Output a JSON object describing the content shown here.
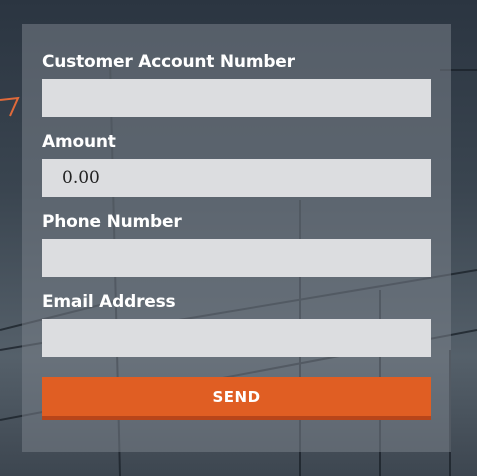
{
  "form": {
    "account": {
      "label": "Customer Account Number",
      "value": ""
    },
    "amount": {
      "label": "Amount",
      "value": "0.00"
    },
    "phone": {
      "label": "Phone Number",
      "value": ""
    },
    "email": {
      "label": "Email Address",
      "value": ""
    },
    "send_label": "SEND"
  },
  "colors": {
    "button": "#e05e23",
    "field": "#dcdde0",
    "panel": "rgba(120,128,136,0.55)"
  }
}
